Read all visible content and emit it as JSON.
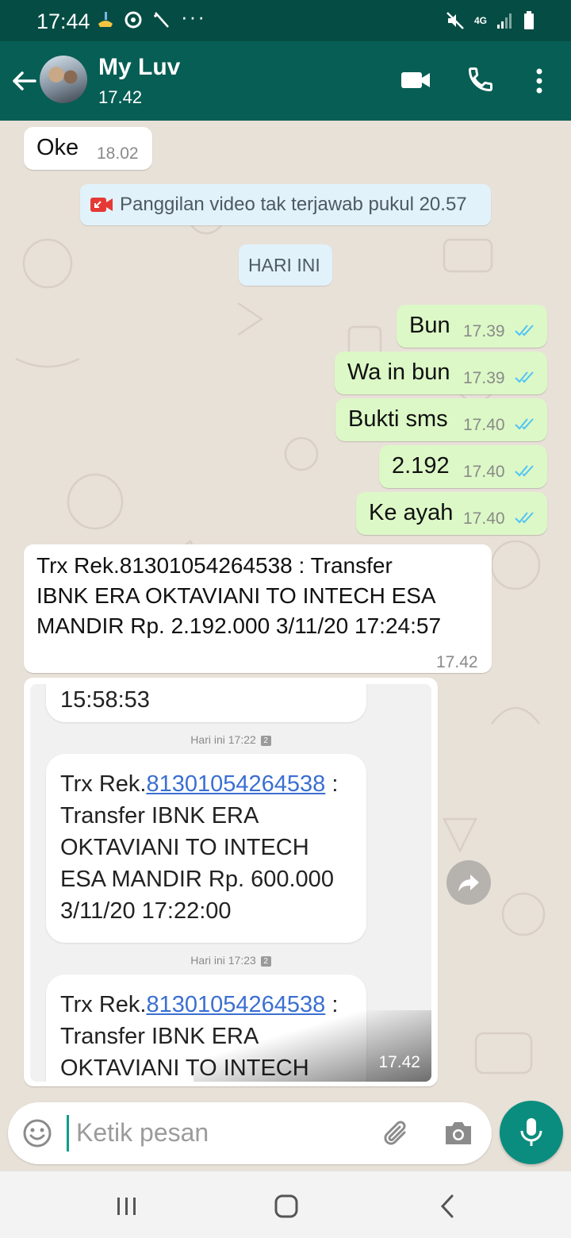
{
  "status_bar": {
    "time": "17:44",
    "network": "4G"
  },
  "header": {
    "contact_name": "My Luv",
    "last_seen": "17.42"
  },
  "messages": {
    "m1": {
      "text": "Oke",
      "time": "18.02"
    },
    "missed_call": {
      "text": "Panggilan video tak terjawab pukul 20.57"
    },
    "date_divider": "HARI INI",
    "out1": {
      "text": "Bun",
      "time": "17.39"
    },
    "out2": {
      "text": "Wa in bun",
      "time": "17.39"
    },
    "out3": {
      "text": "Bukti sms",
      "time": "17.40"
    },
    "out4": {
      "text": "2.192",
      "time": "17.40"
    },
    "out5": {
      "text": "Ke ayah",
      "time": "17.40"
    },
    "in_long": {
      "line1": "Trx Rek.81301054264538 :  Transfer",
      "line2": "IBNK ERA OKTAVIANI  TO INTECH ESA",
      "line3": "MANDIR Rp. 2.192.000 3/11/20 17:24:57",
      "time": "17.42"
    },
    "image": {
      "time": "17.42",
      "sms_top_fragment": "15:58:53",
      "date1": "Hari ini 17:22",
      "date2": "Hari ini 17:23",
      "sim": "2",
      "sms1": {
        "prefix": "Trx Rek.",
        "link": "81301054264538",
        "suffix": " :",
        "line2": "Transfer  IBNK ERA",
        "line3": "OKTAVIANI  TO INTECH",
        "line4": "ESA MANDIR Rp. 600.000",
        "line5": "3/11/20 17:22:00"
      },
      "sms2": {
        "prefix": "Trx Rek.",
        "link": "81301054264538",
        "suffix": " :",
        "line2": "Transfer  IBNK ERA",
        "line3": "OKTAVIANI  TO INTECH"
      }
    }
  },
  "composer": {
    "placeholder": "Ketik pesan"
  },
  "icons": {
    "back": "arrow-left-icon",
    "video": "video-call-icon",
    "call": "phone-icon",
    "more": "more-vert-icon",
    "emoji": "emoji-icon",
    "attach": "paperclip-icon",
    "camera": "camera-icon",
    "mic": "mic-icon",
    "forward": "forward-icon",
    "ticks": "double-check-icon"
  },
  "colors": {
    "header": "#075e54",
    "status": "#054d44",
    "out_bubble": "#dcf8c6",
    "in_bubble": "#ffffff",
    "tick": "#4fc3f7",
    "mic": "#0a8d7e"
  }
}
